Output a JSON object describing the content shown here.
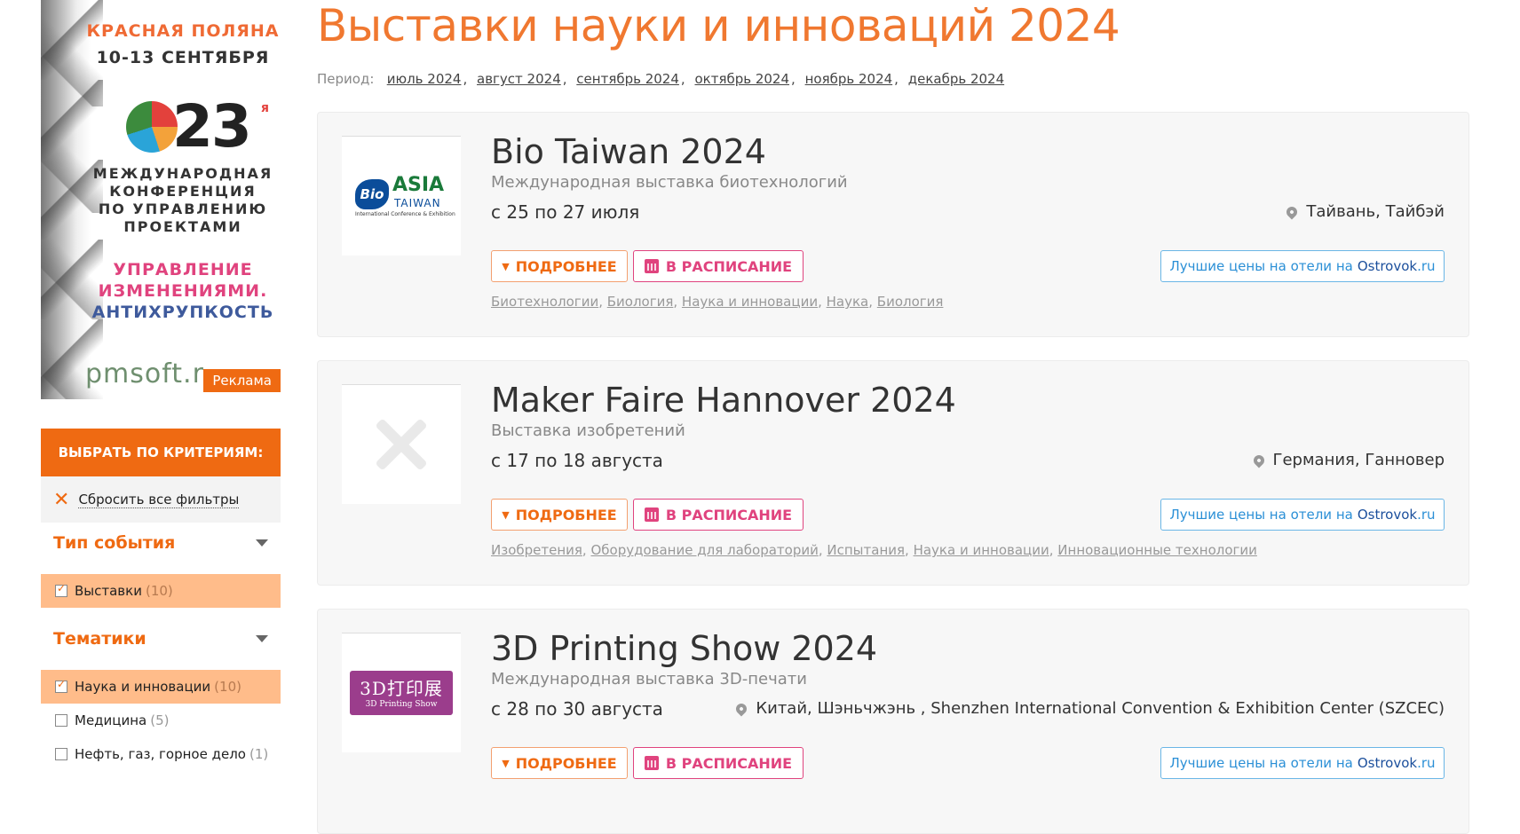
{
  "ad": {
    "line1": "КРАСНАЯ ПОЛЯНА",
    "line2": "10-13 СЕНТЯБРЯ",
    "number": "23",
    "number_suffix": "я",
    "conf_line1": "МЕЖДУНАРОДНАЯ",
    "conf_line2": "КОНФЕРЕНЦИЯ",
    "conf_line3": "ПО УПРАВЛЕНИЮ",
    "conf_line4": "ПРОЕКТАМИ",
    "slogan_line1": "УПРАВЛЕНИЕ",
    "slogan_line2": "ИЗМЕНЕНИЯМИ.",
    "slogan_line3": "АНТИХРУПКОСТЬ",
    "site": "pmsoft.r",
    "badge": "Реклама"
  },
  "criteria": {
    "header": "ВЫБРАТЬ ПО КРИТЕРИЯМ:",
    "reset_label": "Сбросить все фильтры",
    "groups": [
      {
        "title": "Тип события",
        "options": [
          {
            "label": "Выставки",
            "count": "(10)",
            "checked": true
          }
        ]
      },
      {
        "title": "Тематики",
        "options": [
          {
            "label": "Наука и инновации",
            "count": "(10)",
            "checked": true
          },
          {
            "label": "Медицина",
            "count": "(5)",
            "checked": false
          },
          {
            "label": "Нефть, газ, горное дело",
            "count": "(1)",
            "checked": false
          }
        ]
      }
    ]
  },
  "page": {
    "title": "Выставки науки и инноваций 2024",
    "period_label": "Период:",
    "periods": [
      "июль 2024",
      "август 2024",
      "сентябрь 2024",
      "октябрь 2024",
      "ноябрь 2024",
      "декабрь 2024"
    ]
  },
  "buttons": {
    "more": "ПОДРОБНЕЕ",
    "schedule": "В РАСПИСАНИЕ",
    "hotel_prefix": "Лучшие цены на отели на",
    "hotel_brand": "Ostrovok",
    "hotel_tld": ".ru"
  },
  "events": [
    {
      "name": "Bio Taiwan 2024",
      "subtitle": "Международная выставка биотехнологий",
      "dates": "с 25 по 27 июля",
      "location": "Тайвань, Тайбэй",
      "logo_text": {
        "bio": "Bio",
        "asia": "ASIA",
        "taiwan": "TAIWAN",
        "small": "International Conference & Exhibition"
      },
      "tags": [
        "Биотехнологии",
        "Биология",
        "Наука и инновации",
        "Наука",
        "Биология"
      ]
    },
    {
      "name": "Maker Faire Hannover 2024",
      "subtitle": "Выставка изобретений",
      "dates": "с 17 по 18 августа",
      "location": "Германия, Ганновер",
      "tags": [
        "Изобретения",
        "Оборудование для лабораторий",
        "Испытания",
        "Наука и инновации",
        "Инновационные технологии"
      ]
    },
    {
      "name": "3D Printing Show 2024",
      "subtitle": "Международная выставка 3D-печати",
      "dates": "с 28 по 30 августа",
      "location": "Китай, Шэньчжэнь , Shenzhen International Convention & Exhibition Center (SZCEC)",
      "logo_text": {
        "cn": "3D打印展",
        "en": "3D Printing Show"
      },
      "tags": []
    }
  ],
  "colors": {
    "accent": "#ef6a12",
    "title": "#f07830",
    "schedule": "#e0437e",
    "hotel": "#2a8fd6"
  }
}
